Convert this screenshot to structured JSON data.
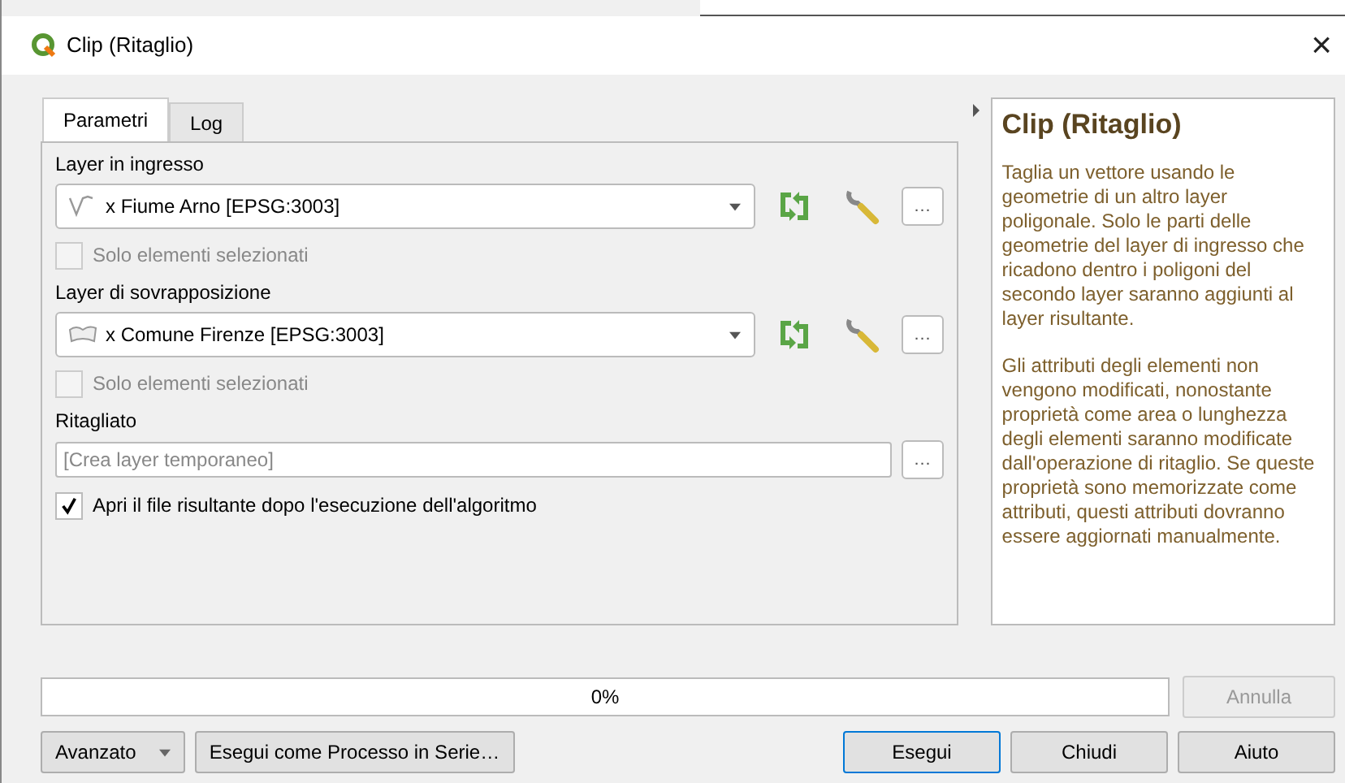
{
  "window": {
    "title": "Clip (Ritaglio)",
    "close": "×"
  },
  "tabs": [
    {
      "label": "Parametri",
      "selected": true
    },
    {
      "label": "Log",
      "selected": false
    }
  ],
  "params": [
    {
      "kind": "layer",
      "label": "Layer in ingresso",
      "layer": {
        "kind": "line",
        "name": "x Fiume Arno [EPSG:3003]"
      },
      "options_button": "…",
      "checkbox": {
        "label": "Solo elementi selezionati",
        "checked": false,
        "disabled": true
      }
    },
    {
      "kind": "layer",
      "label": "Layer di sovrapposizione",
      "layer": {
        "kind": "polygon",
        "name": "x Comune Firenze [EPSG:3003]"
      },
      "options_button": "…",
      "checkbox": {
        "label": "Solo elementi selezionati",
        "checked": false,
        "disabled": true
      }
    },
    {
      "kind": "output",
      "label": "Ritagliato",
      "placeholder": "[Crea layer temporaneo]",
      "options_button": "…",
      "checkbox": {
        "label": "Apri il file risultante dopo l'esecuzione dell'algoritmo",
        "checked": true,
        "disabled": false
      }
    }
  ],
  "help": {
    "title": "Clip (Ritaglio)",
    "paragraphs": [
      "Taglia un vettore usando le geometrie di un altro layer poligonale. Solo le parti delle geometrie del layer di ingresso che ricadono dentro i poligoni del secondo layer saranno aggiunti al layer risultante.",
      "Gli attributi degli elementi non vengono modificati, nonostante proprietà come area o lunghezza degli elementi saranno modificate dall'operazione di ritaglio. Se queste proprietà sono memorizzate come attributi, questi attributi dovranno essere aggiornati manualmente."
    ]
  },
  "progress": {
    "level": 0,
    "text": "0%"
  },
  "cancel": {
    "label": "Annulla",
    "disabled": true
  },
  "buttons": [
    {
      "label": "Avanzato",
      "kind": "menu"
    },
    {
      "label": "Esegui come Processo in Serie…",
      "kind": "plain"
    },
    {
      "label": "Esegui",
      "kind": "default"
    },
    {
      "label": "Chiudi",
      "kind": "plain"
    },
    {
      "label": "Aiuto",
      "kind": "plain"
    }
  ]
}
